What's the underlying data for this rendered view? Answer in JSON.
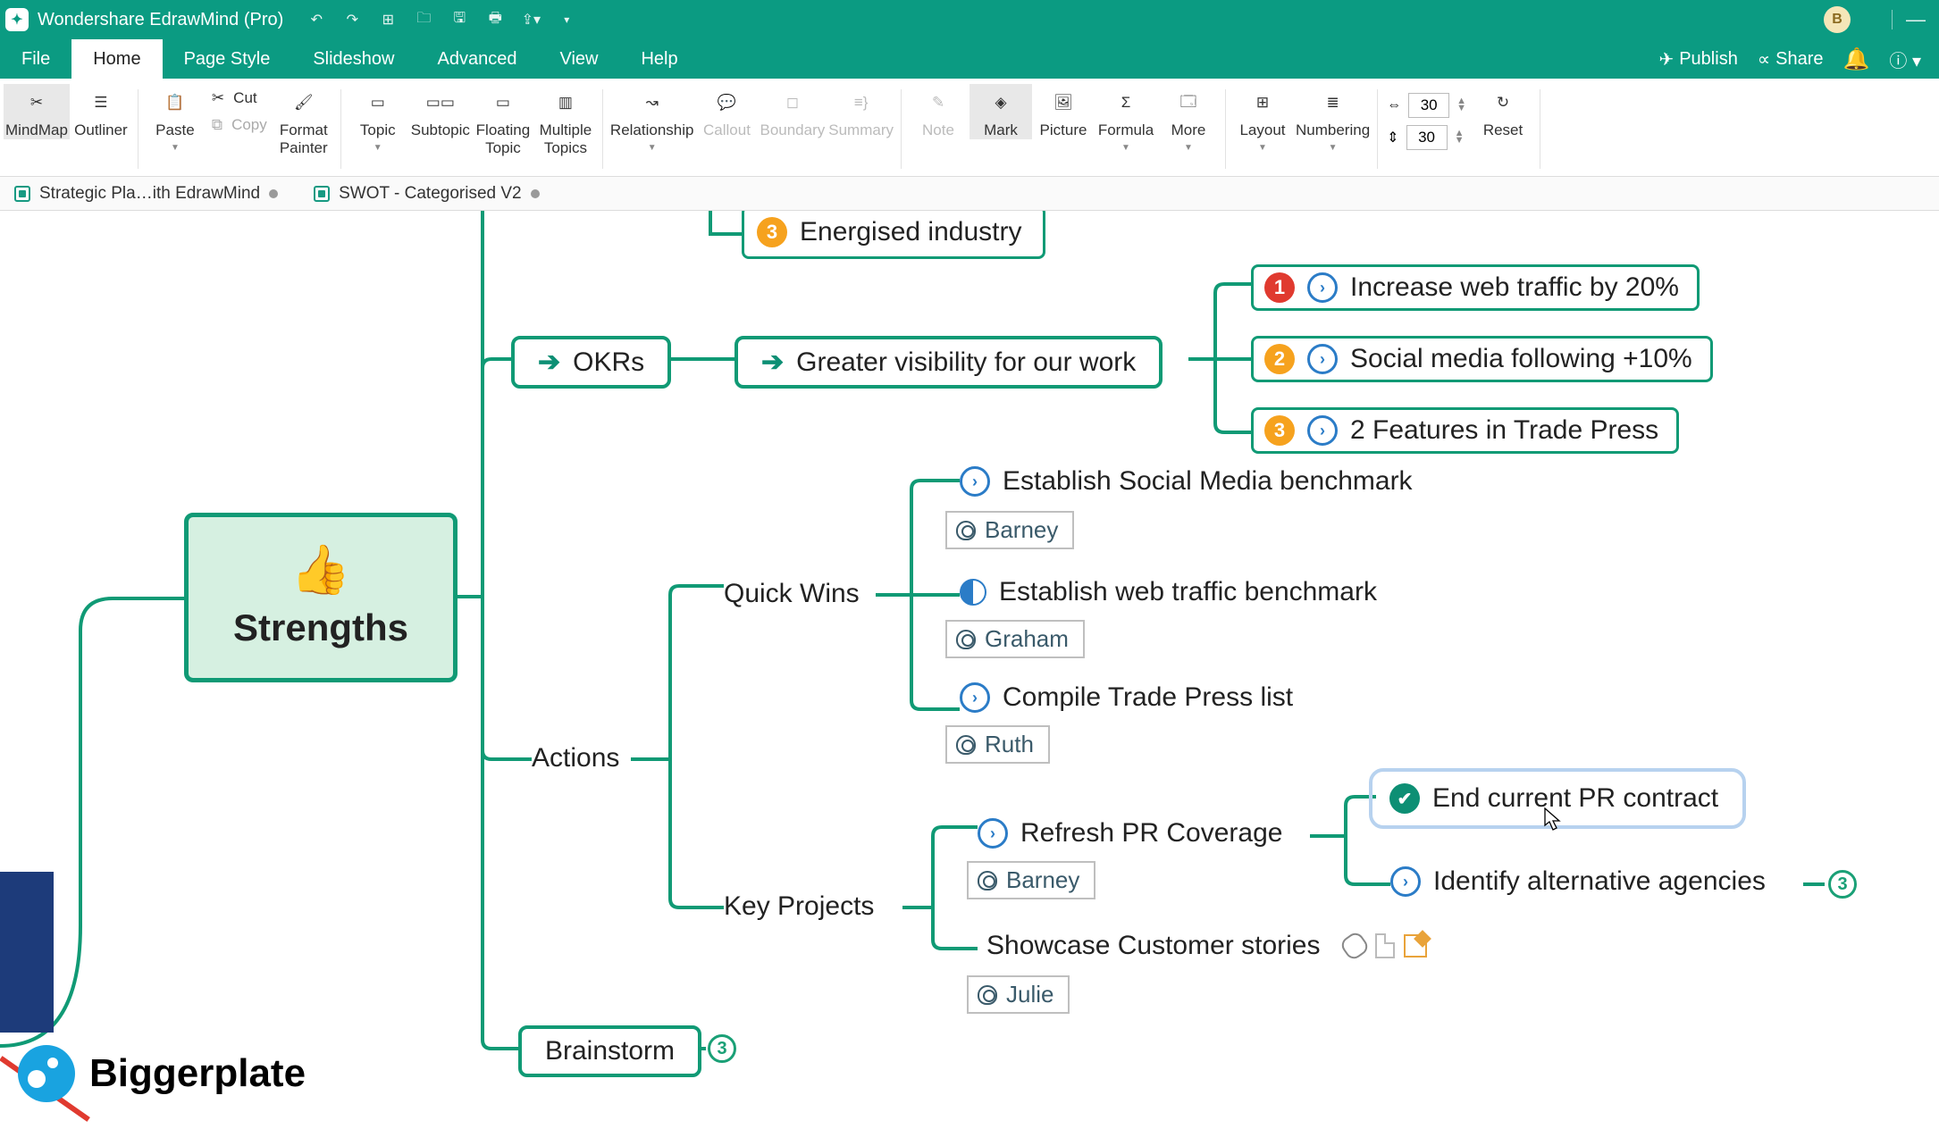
{
  "app": {
    "title": "Wondershare EdrawMind (Pro)",
    "user_initial": "B"
  },
  "menu": {
    "items": [
      "File",
      "Home",
      "Page Style",
      "Slideshow",
      "Advanced",
      "View",
      "Help"
    ],
    "active": 1,
    "right": {
      "publish": "Publish",
      "share": "Share"
    }
  },
  "ribbon": {
    "mindmap": "MindMap",
    "outliner": "Outliner",
    "paste": "Paste",
    "cut": "Cut",
    "copy": "Copy",
    "format_painter_l1": "Format",
    "format_painter_l2": "Painter",
    "topic": "Topic",
    "subtopic": "Subtopic",
    "floating_l1": "Floating",
    "floating_l2": "Topic",
    "multiple_l1": "Multiple",
    "multiple_l2": "Topics",
    "relationship": "Relationship",
    "callout": "Callout",
    "boundary": "Boundary",
    "summary": "Summary",
    "note": "Note",
    "mark": "Mark",
    "picture": "Picture",
    "formula": "Formula",
    "more": "More",
    "layout": "Layout",
    "numbering": "Numbering",
    "reset": "Reset",
    "hspace": "30",
    "vspace": "30"
  },
  "tabs": {
    "t1": "Strategic Pla…ith EdrawMind",
    "t2": "SWOT - Categorised V2"
  },
  "mindmap": {
    "root": "Strengths",
    "energised": "Energised industry",
    "okrs": "OKRs",
    "gvisibility": "Greater visibility for our work",
    "kr1": "Increase web traffic by 20%",
    "kr2": "Social media following +10%",
    "kr3": "2 Features in Trade Press",
    "actions": "Actions",
    "quickwins": "Quick Wins",
    "qw1": "Establish Social Media benchmark",
    "qw2": "Establish web traffic benchmark",
    "qw3": "Compile Trade Press list",
    "keyprojects": "Key Projects",
    "kp1": "Refresh PR Coverage",
    "kp2": "Showcase Customer stories",
    "pr1": "End current PR contract",
    "pr2": "Identify alternative agencies",
    "brainstorm": "Brainstorm",
    "persons": {
      "barney": "Barney",
      "graham": "Graham",
      "ruth": "Ruth",
      "julie": "Julie"
    }
  },
  "watermark": "Biggerplate"
}
